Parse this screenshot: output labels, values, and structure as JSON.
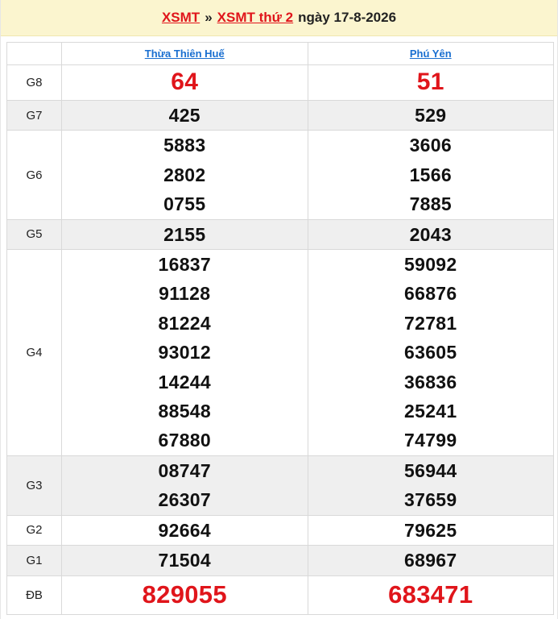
{
  "header": {
    "link1": "XSMT",
    "separator": "»",
    "link2": "XSMT thứ 2",
    "date_text": "ngày 17-8-2026"
  },
  "provinces": [
    "Thừa Thiên Huế",
    "Phú Yên"
  ],
  "prizes": [
    {
      "label": "G8",
      "col1": [
        "64"
      ],
      "col2": [
        "51"
      ]
    },
    {
      "label": "G7",
      "col1": [
        "425"
      ],
      "col2": [
        "529"
      ]
    },
    {
      "label": "G6",
      "col1": [
        "5883",
        "2802",
        "0755"
      ],
      "col2": [
        "3606",
        "1566",
        "7885"
      ]
    },
    {
      "label": "G5",
      "col1": [
        "2155"
      ],
      "col2": [
        "2043"
      ]
    },
    {
      "label": "G4",
      "col1": [
        "16837",
        "91128",
        "81224",
        "93012",
        "14244",
        "88548",
        "67880"
      ],
      "col2": [
        "59092",
        "66876",
        "72781",
        "63605",
        "36836",
        "25241",
        "74799"
      ]
    },
    {
      "label": "G3",
      "col1": [
        "08747",
        "26307"
      ],
      "col2": [
        "56944",
        "37659"
      ]
    },
    {
      "label": "G2",
      "col1": [
        "92664"
      ],
      "col2": [
        "79625"
      ]
    },
    {
      "label": "G1",
      "col1": [
        "71504"
      ],
      "col2": [
        "68967"
      ]
    },
    {
      "label": "ĐB",
      "col1": [
        "829055"
      ],
      "col2": [
        "683471"
      ]
    }
  ],
  "colors": {
    "accent_red": "#e0151b",
    "link_blue": "#1a6fd0",
    "header_bg": "#fbf5cf",
    "row_gray": "#efefef"
  }
}
